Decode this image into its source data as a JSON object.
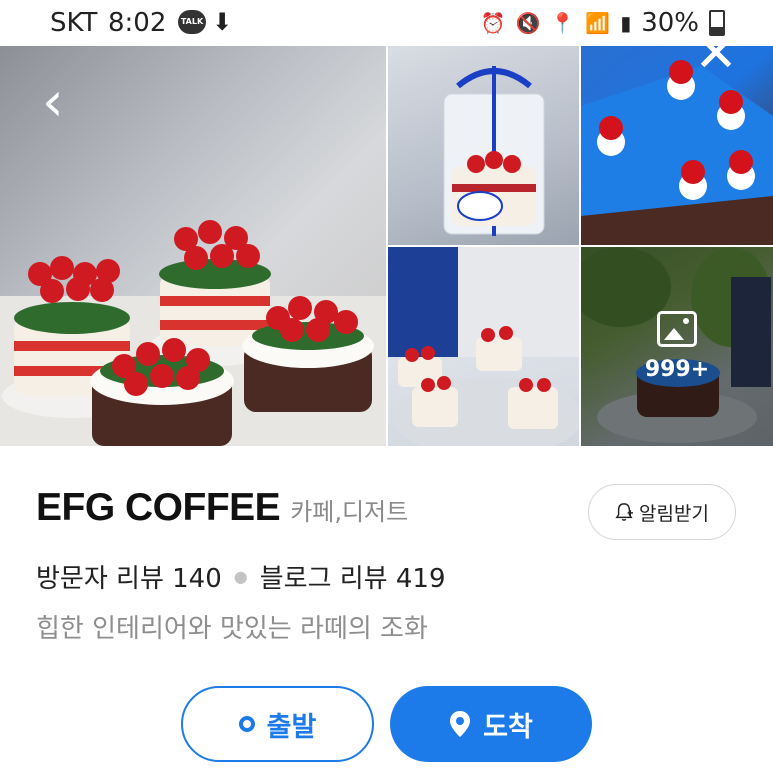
{
  "status_bar": {
    "carrier": "SKT",
    "time": "8:02",
    "talk_badge": "TALK",
    "battery": "30%",
    "icons": [
      "talk-icon",
      "download-icon",
      "alarm-icon",
      "mute-icon",
      "location-icon",
      "wifi-icon",
      "signal-icon",
      "battery-icon"
    ]
  },
  "gallery": {
    "more_count": "999+"
  },
  "place": {
    "name": "EFG COFFEE",
    "category": "카페,디저트",
    "notify_label": "알림받기",
    "visitor_reviews": "방문자 리뷰 140",
    "blog_reviews": "블로그 리뷰 419",
    "description": "힙한 인테리어와 맛있는 라떼의 조화"
  },
  "actions": {
    "depart_label": "출발",
    "arrive_label": "도착"
  },
  "colors": {
    "accent": "#1c7be8"
  }
}
